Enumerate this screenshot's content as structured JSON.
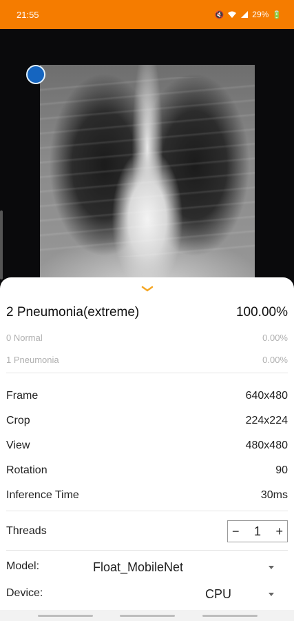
{
  "status_bar": {
    "time": "21:55",
    "battery": "29%",
    "icons": [
      "mute-icon",
      "wifi-icon",
      "signal-icon",
      "battery-saver-icon"
    ]
  },
  "colors": {
    "status_bar": "#f57c00",
    "chevron": "#f5a623"
  },
  "results": {
    "top": {
      "label": "2 Pneumonia(extreme)",
      "value": "100.00%"
    },
    "others": [
      {
        "label": "0 Normal",
        "value": "0.00%"
      },
      {
        "label": "1 Pneumonia",
        "value": "0.00%"
      }
    ]
  },
  "info": {
    "frame_label": "Frame",
    "frame_value": "640x480",
    "crop_label": "Crop",
    "crop_value": "224x224",
    "view_label": "View",
    "view_value": "480x480",
    "rotation_label": "Rotation",
    "rotation_value": "90",
    "inference_label": "Inference Time",
    "inference_value": "30ms"
  },
  "threads": {
    "label": "Threads",
    "value": "1",
    "minus": "−",
    "plus": "+"
  },
  "model": {
    "label": "Model:",
    "value": "Float_MobileNet"
  },
  "device": {
    "label": "Device:",
    "value": "CPU"
  }
}
